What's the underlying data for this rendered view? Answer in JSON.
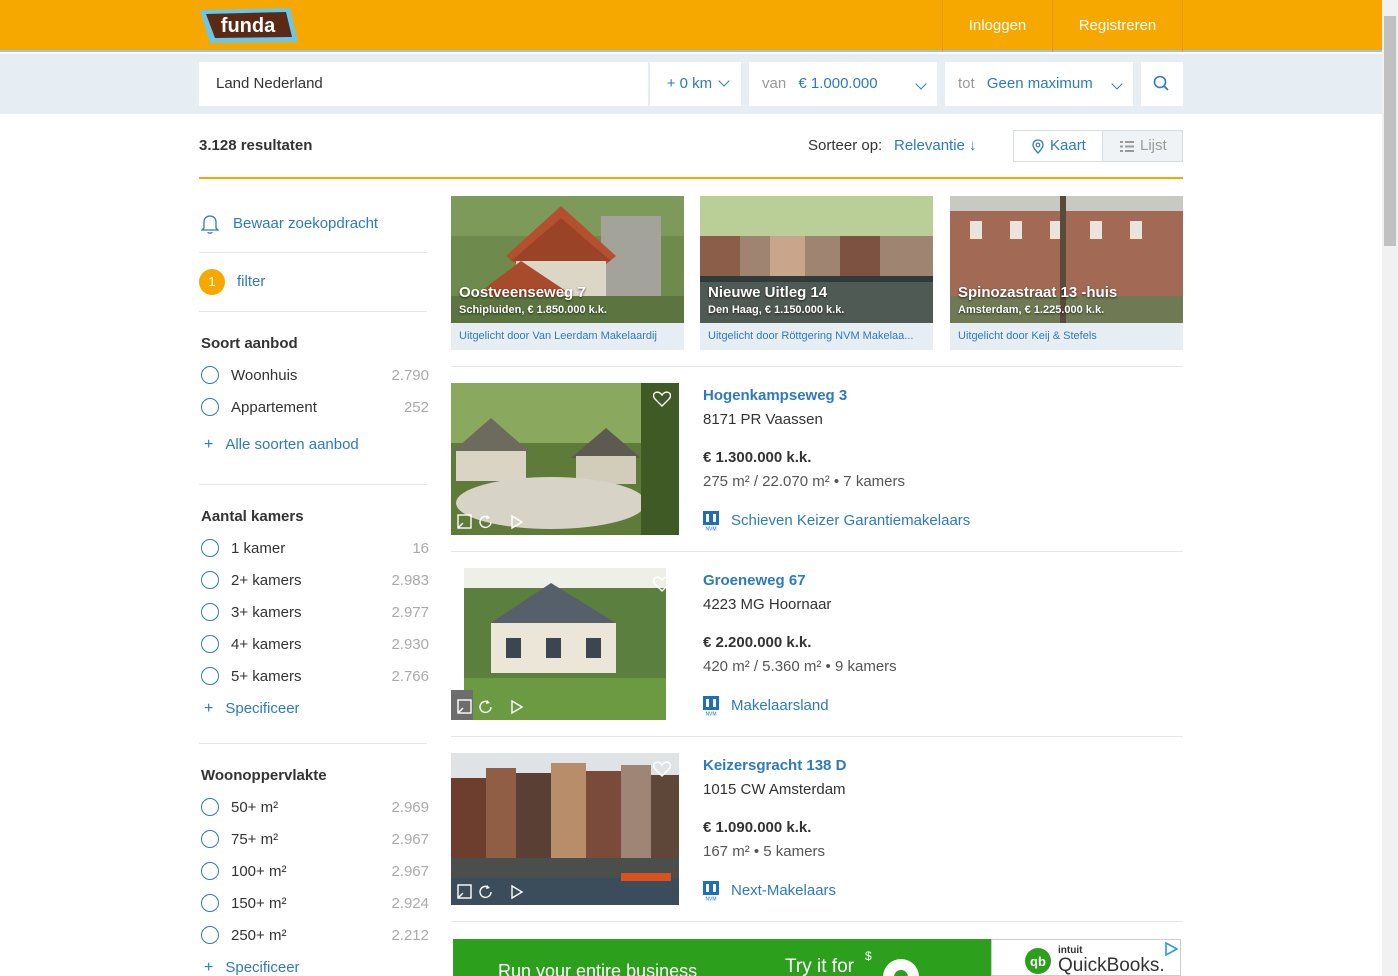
{
  "header": {
    "logo_text": "funda",
    "login": "Inloggen",
    "register": "Registreren"
  },
  "search": {
    "location": "Land Nederland",
    "radius": "+ 0 km",
    "from_label": "van",
    "from_value": "€ 1.000.000",
    "to_label": "tot",
    "to_value": "Geen maximum"
  },
  "results": {
    "count": "3.128 resultaten",
    "sort_label": "Sorteer op:",
    "sort_value": "Relevantie ↓",
    "view_map": "Kaart",
    "view_list": "Lijst"
  },
  "sidebar": {
    "save_search": "Bewaar zoekopdracht",
    "filter_count": "1",
    "filter_label": "filter",
    "type": {
      "heading": "Soort aanbod",
      "options": [
        {
          "label": "Woonhuis",
          "count": "2.790"
        },
        {
          "label": "Appartement",
          "count": "252"
        }
      ],
      "more": "Alle soorten aanbod"
    },
    "rooms": {
      "heading": "Aantal kamers",
      "options": [
        {
          "label": "1 kamer",
          "count": "16"
        },
        {
          "label": "2+ kamers",
          "count": "2.983"
        },
        {
          "label": "3+ kamers",
          "count": "2.977"
        },
        {
          "label": "4+ kamers",
          "count": "2.930"
        },
        {
          "label": "5+ kamers",
          "count": "2.766"
        }
      ],
      "more": "Specificeer"
    },
    "area": {
      "heading": "Woonoppervlakte",
      "options": [
        {
          "label": "50+ m²",
          "count": "2.969"
        },
        {
          "label": "75+ m²",
          "count": "2.967"
        },
        {
          "label": "100+ m²",
          "count": "2.967"
        },
        {
          "label": "150+ m²",
          "count": "2.924"
        },
        {
          "label": "250+ m²",
          "count": "2.212"
        }
      ],
      "more": "Specificeer"
    }
  },
  "featured": [
    {
      "title": "Oostveenseweg 7",
      "sub": "Schipluiden, € 1.850.000 k.k.",
      "foot": "Uitgelicht door Van Leerdam Makelaardij"
    },
    {
      "title": "Nieuwe Uitleg 14",
      "sub": "Den Haag, € 1.150.000 k.k.",
      "foot": "Uitgelicht door Röttgering NVM Makelaa..."
    },
    {
      "title": "Spinozastraat 13 -huis",
      "sub": "Amsterdam, € 1.225.000 k.k.",
      "foot": "Uitgelicht door Keij & Stefels"
    }
  ],
  "listings": [
    {
      "title": "Hogenkampseweg 3",
      "address": "8171 PR Vaassen",
      "price": "€ 1.300.000 k.k.",
      "specs": "275 m² / 22.070 m² • 7 kamers",
      "agent": "Schieven Keizer Garantiemakelaars"
    },
    {
      "title": "Groeneweg 67",
      "address": "4223 MG Hoornaar",
      "price": "€ 2.200.000 k.k.",
      "specs": "420 m² / 5.360 m² • 9 kamers",
      "agent": "Makelaarsland"
    },
    {
      "title": "Keizersgracht 138 D",
      "address": "1015 CW Amsterdam",
      "price": "€ 1.090.000 k.k.",
      "specs": "167 m² • 5 kamers",
      "agent": "Next-Makelaars"
    }
  ],
  "ad": {
    "text1": "Run your entire business",
    "text2": "Try it for",
    "brand_small": "intuit",
    "brand": "QuickBooks."
  },
  "colors": {
    "brand_orange": "#f7a800",
    "link_blue": "#2d7ac0",
    "search_bg": "#e6eef4"
  }
}
